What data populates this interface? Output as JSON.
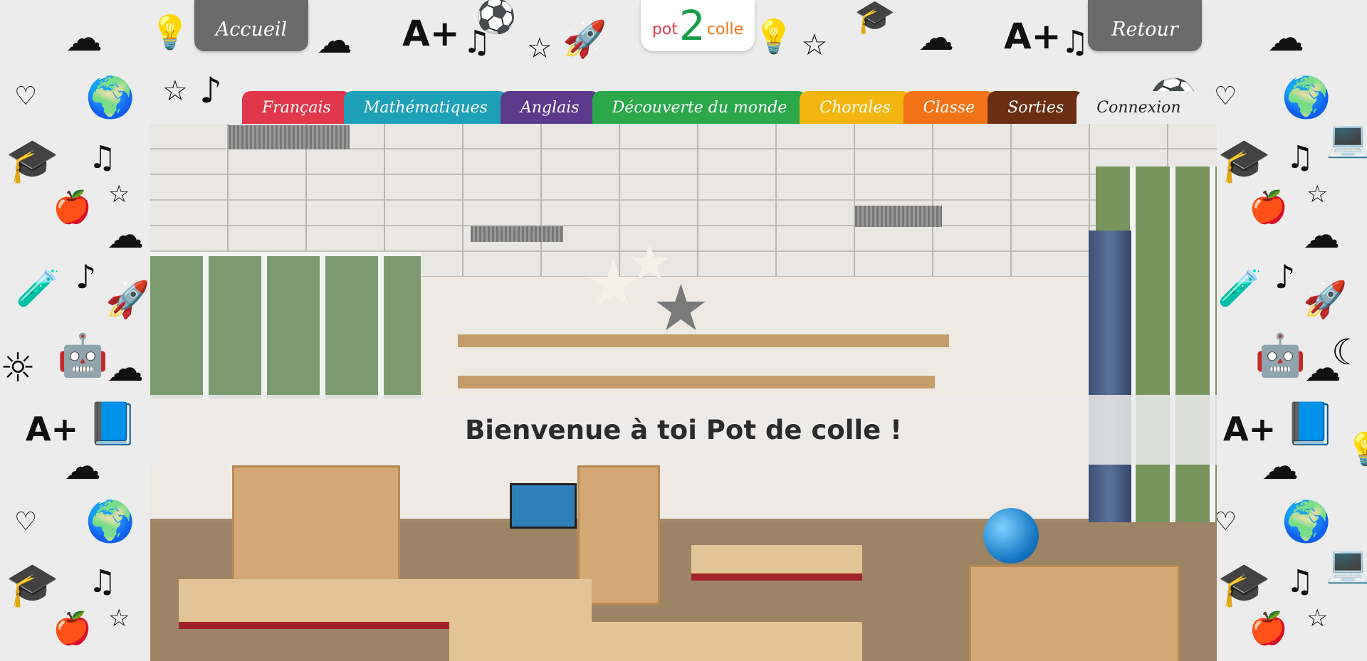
{
  "header": {
    "home_button": "Accueil",
    "back_button": "Retour",
    "logo": {
      "prefix": "pot",
      "number": "2",
      "suffix": "colle"
    }
  },
  "nav": {
    "tabs": [
      {
        "label": "Français",
        "color": "#e0384a"
      },
      {
        "label": "Mathématiques",
        "color": "#1ea0b8"
      },
      {
        "label": "Anglais",
        "color": "#5b3a8c"
      },
      {
        "label": "Découverte du monde",
        "color": "#2aa84a"
      },
      {
        "label": "Chorales",
        "color": "#f3b611"
      },
      {
        "label": "Classe",
        "color": "#f27218"
      },
      {
        "label": "Sorties",
        "color": "#6a2f12"
      },
      {
        "label": "Connexion",
        "color": "#ececec"
      }
    ]
  },
  "hero": {
    "welcome": "Bienvenue à toi Pot de colle !",
    "image": "classroom-photo"
  },
  "colors": {
    "button_gray": "#6b6b6b",
    "logo_green": "#1a9d4a",
    "background": "#ececec"
  }
}
